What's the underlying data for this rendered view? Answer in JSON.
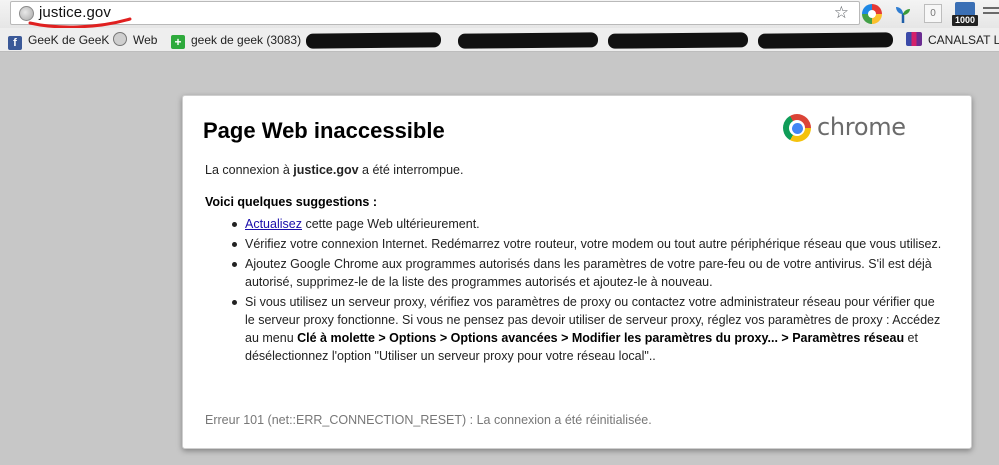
{
  "browser": {
    "url": "justice.gov",
    "extension_counter": "0",
    "feed_count": "1000"
  },
  "bookmarks": [
    {
      "label": "GeeK de GeeK",
      "icon": "facebook-icon"
    },
    {
      "label": "Web",
      "icon": "globe-icon"
    },
    {
      "label": "geek de geek (3083)",
      "icon": "plus-icon"
    },
    {
      "label": "CANALSAT LI",
      "icon": "canalsat-icon"
    }
  ],
  "error_page": {
    "logo_text": "chrome",
    "title": "Page Web inaccessible",
    "summary_prefix": "La connexion à ",
    "summary_host": "justice.gov",
    "summary_suffix": " a été interrompue.",
    "suggestions_heading": "Voici quelques suggestions :",
    "suggestion_1_link": "Actualisez",
    "suggestion_1_text": " cette page Web ultérieurement.",
    "suggestion_2_text": "Vérifiez votre connexion Internet. Redémarrez votre routeur, votre modem ou tout autre périphérique réseau que vous utilisez.",
    "suggestion_3_text": "Ajoutez Google Chrome aux programmes autorisés dans les paramètres de votre pare-feu ou de votre antivirus. S'il est déjà autorisé, supprimez-le de la liste des programmes autorisés et ajoutez-le à nouveau.",
    "suggestion_4_text": "Si vous utilisez un serveur proxy, vérifiez vos paramètres de proxy ou contactez votre administrateur réseau pour vérifier que le serveur proxy fonctionne. Si vous ne pensez pas devoir utiliser de serveur proxy, réglez vos paramètres de proxy : Accédez au menu ",
    "suggestion_4_menu_path": "Clé à molette > Options > Options avancées > Modifier les paramètres du proxy... > Paramètres réseau",
    "suggestion_4_suffix": " et désélectionnez l'option \"Utiliser un serveur proxy pour votre réseau local\"..",
    "error_code": "Erreur 101 (net::ERR_CONNECTION_RESET) : La connexion a été réinitialisée."
  },
  "colors": {
    "page_background": "#c7c7c7",
    "link": "#1a0dab",
    "annotation_red": "#e02020"
  }
}
